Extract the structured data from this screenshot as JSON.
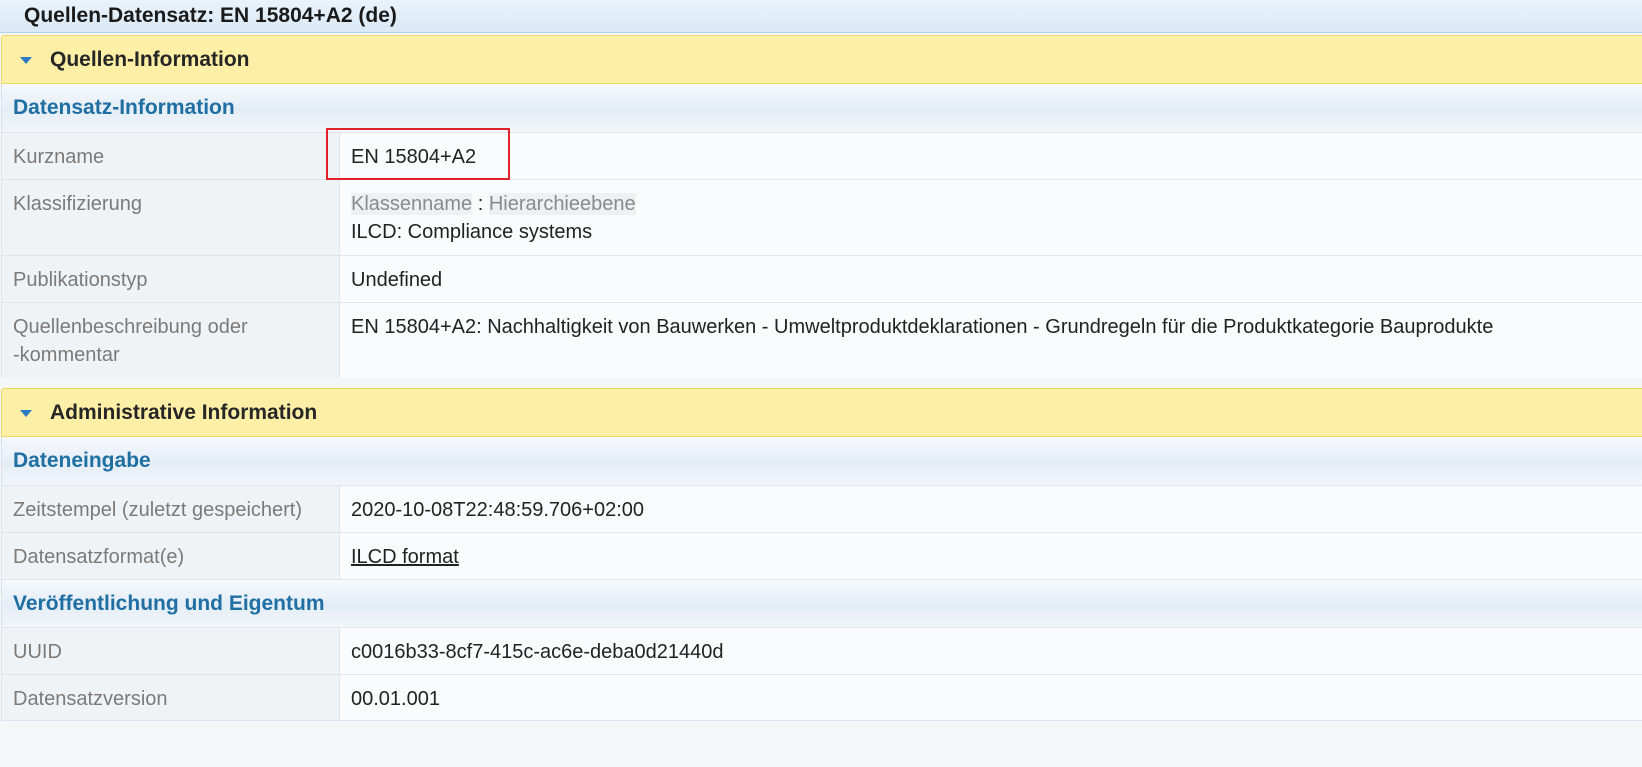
{
  "window": {
    "title": "Quellen-Datensatz: EN 15804+A2 (de)"
  },
  "panels": {
    "source": {
      "title": "Quellen-Information",
      "section": "Datensatz-Information",
      "rows": {
        "kurzname": {
          "label": "Kurzname",
          "value": "EN 15804+A2"
        },
        "klassifizierung": {
          "label": "Klassifizierung",
          "value_key_a": "Klassenname",
          "value_sep": " : ",
          "value_key_b": "Hierarchieebene",
          "value": "ILCD: Compliance systems"
        },
        "publikationstyp": {
          "label": "Publikationstyp",
          "value": "Undefined"
        },
        "beschreibung": {
          "label_line1": "Quellenbeschreibung oder",
          "label_line2": "-kommentar",
          "value": "EN 15804+A2: Nachhaltigkeit von Bauwerken - Umweltproduktdeklarationen - Grundregeln für die Produktkategorie Bauprodukte"
        }
      }
    },
    "admin": {
      "title": "Administrative Information",
      "section_entry": "Dateneingabe",
      "rows_entry": {
        "timestamp": {
          "label": "Zeitstempel (zuletzt gespeichert)",
          "value": "2020-10-08T22:48:59.706+02:00"
        },
        "format": {
          "label": "Datensatzformat(e)",
          "value": "ILCD format"
        }
      },
      "section_publication": "Veröffentlichung und Eigentum",
      "rows_publication": {
        "uuid": {
          "label": "UUID",
          "value": "c0016b33-8cf7-415c-ac6e-deba0d21440d"
        },
        "version": {
          "label": "Datensatzversion",
          "value": "00.01.001"
        }
      }
    }
  },
  "colors": {
    "panel_header_bg": "#fdf0a6",
    "section_title": "#1f6fa3",
    "toggle_arrow": "#2f78c4",
    "highlight_border": "#e2222a"
  },
  "icons": {
    "toggle": "caret-down-icon"
  }
}
